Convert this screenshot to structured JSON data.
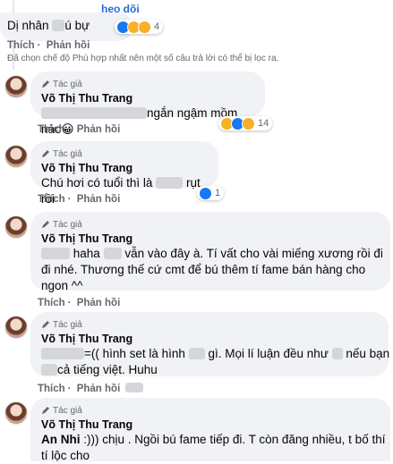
{
  "top": {
    "partial_link": "heo dõi",
    "comment_pre": "Dị nhân",
    "comment_post": "ú bự",
    "reaction_count": "4",
    "like_label": "Thích",
    "dot": "·",
    "reply_label": "Phản hồi",
    "notice": "Đã chọn chế độ Phù hợp nhất nên một số câu trả lời có thể bị lọc ra."
  },
  "author_badge": "Tác giả",
  "author_name": "Võ Thị Thu Trang",
  "replies": [
    {
      "pre": "",
      "post": "ngắn ngậm mồm nào😀",
      "reaction_count": "14",
      "like_label": "Thích",
      "reply_label": "Phản hồi"
    },
    {
      "pre": "Chú hơi có tuổi thì là",
      "post": "rụt rồi",
      "reaction_count": "1",
      "like_label": "Thích",
      "reply_label": "Phản hồi"
    },
    {
      "line1_a": "haha",
      "line1_b": "vẫn vào đây à. Tí vất cho vài miếng xương rồi đi",
      "line2": "đi nhé. Thương thế cứ cmt để bú thêm tí fame bán hàng cho",
      "line3": "ngon ^^",
      "like_label": "Thích",
      "reply_label": "Phản hồi"
    },
    {
      "line1_a": "=(( hình set là hình",
      "line1_b": "gì. Mọi lí luận đều như",
      "line1_c": "nếu bạn",
      "line2": "cả tiếng việt. Huhu",
      "like_label": "Thích",
      "reply_label": "Phản hồi"
    },
    {
      "mention": "An Nhi",
      "line1": ":))) chịu . Ngồi bú fame tiếp đi. T còn đăng nhiều, t bố thí",
      "line2": "tí lộc cho"
    }
  ],
  "icons": [
    "pencil-icon",
    "like-reaction-icon",
    "haha-reaction-icon",
    "wow-reaction-icon"
  ],
  "colors": {
    "link": "#216fdb",
    "bubble": "#f0f2f5",
    "meta": "#65676b",
    "like": "#1877f2",
    "haha": "#f7b125"
  }
}
